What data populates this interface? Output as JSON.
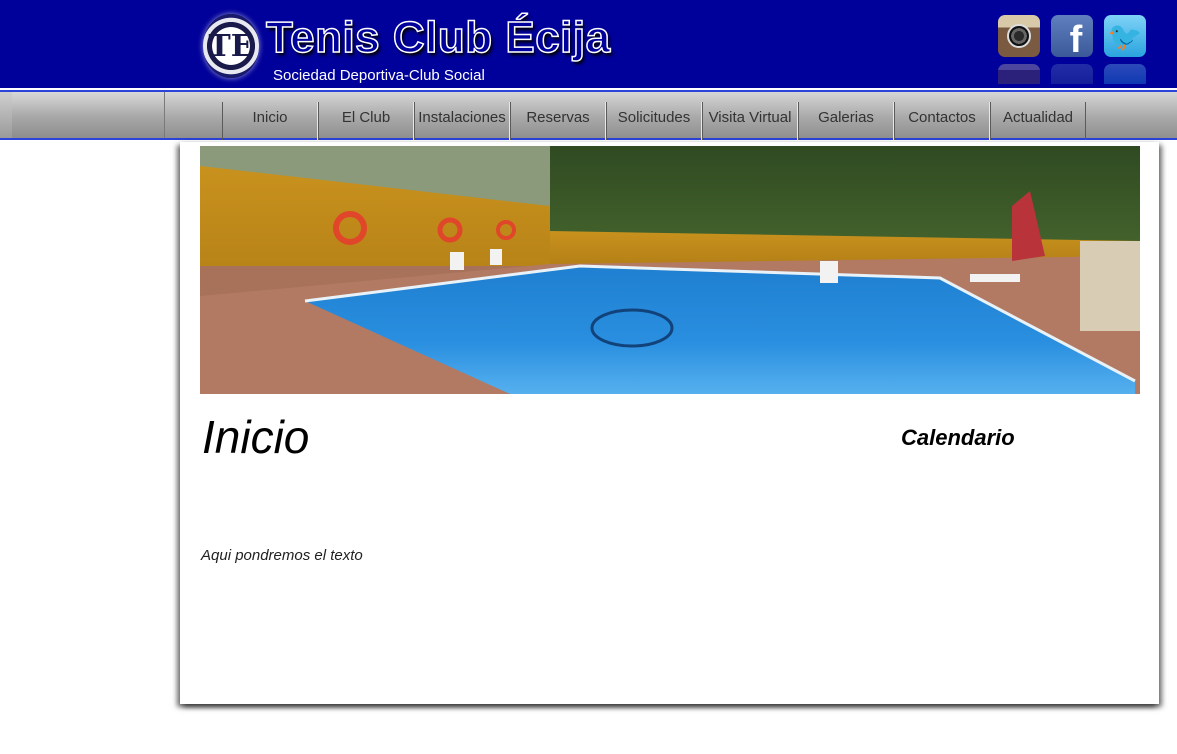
{
  "header": {
    "logo_monogram": "TE",
    "title": "Tenis Club Écija",
    "subtitle": "Sociedad Deportiva-Club Social",
    "social": [
      {
        "name": "instagram",
        "icon": "instagram-icon"
      },
      {
        "name": "facebook",
        "icon": "facebook-icon",
        "glyph": "f"
      },
      {
        "name": "twitter",
        "icon": "twitter-icon",
        "glyph": "🐦"
      }
    ]
  },
  "nav": {
    "items": [
      "Inicio",
      "El Club",
      "Instalaciones",
      "Reservas",
      "Solicitudes",
      "Visita Virtual",
      "Galerias",
      "Contactos",
      "Actualidad"
    ]
  },
  "main": {
    "hero_alt": "panoramic swimming pool photo",
    "title": "Inicio",
    "calendar_title": "Calendario",
    "body_text": "Aqui pondremos el texto"
  },
  "colors": {
    "header_bg": "#00009a",
    "nav_border": "#2c42d8"
  }
}
